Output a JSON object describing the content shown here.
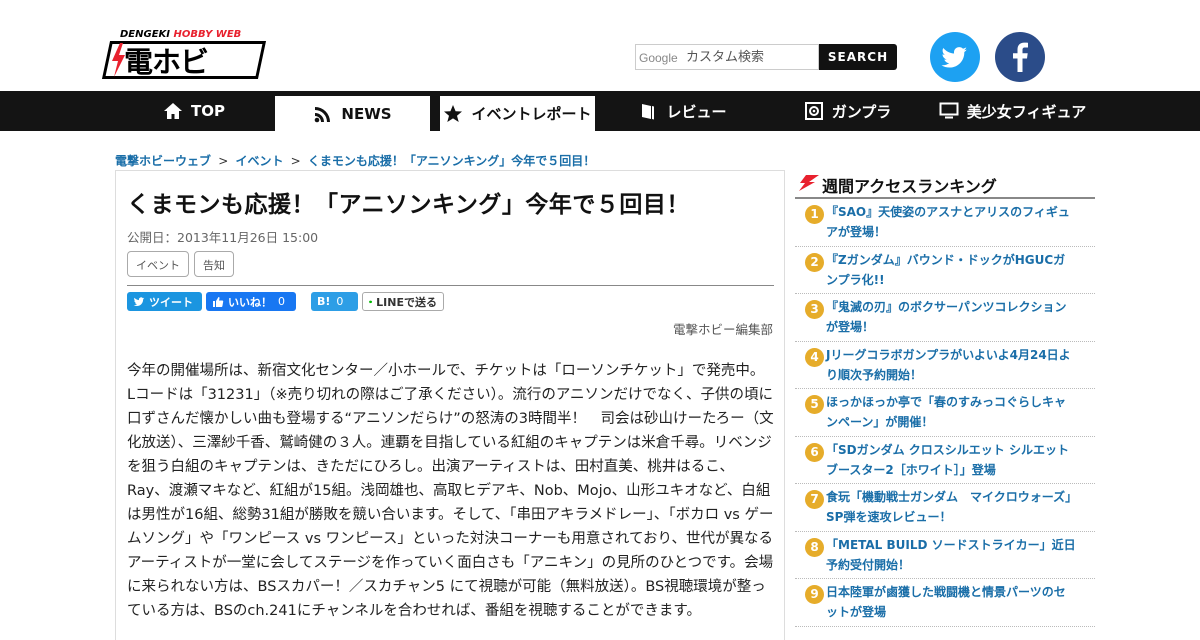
{
  "header": {
    "logo_top_a": "DENGEKI ",
    "logo_top_b": "HOBBY WEB",
    "logo_main": "電ホビ",
    "search_brand": "Google",
    "search_placeholder": "カスタム検索",
    "search_button": "SEARCH"
  },
  "nav": {
    "items": [
      {
        "label": "TOP",
        "icon": "home-icon"
      },
      {
        "label": "NEWS",
        "icon": "rss-icon"
      },
      {
        "label": "イベントレポート",
        "icon": "star-icon"
      },
      {
        "label": "レビュー",
        "icon": "book-icon"
      },
      {
        "label": "ガンプラ",
        "icon": "gear-icon"
      },
      {
        "label": "美少女フィギュア",
        "icon": "monitor-icon"
      }
    ]
  },
  "breadcrumb": {
    "items": [
      "電撃ホビーウェブ",
      "イベント",
      "くまモンも応援！「アニソンキング」今年で５回目！"
    ],
    "sep": ">"
  },
  "article": {
    "title": "くまモンも応援！「アニソンキング」今年で５回目！",
    "published": "公開日：2013年11月26日 15:00",
    "tags": [
      "イベント",
      "告知"
    ],
    "share": {
      "tweet": "ツイート",
      "like": "いいね！",
      "like_count": "0",
      "hatena": "B!",
      "hatena_count": "0",
      "line": "LINEで送る"
    },
    "author": "電撃ホビー編集部",
    "body": "今年の開催場所は、新宿文化センター／小ホールで、チケットは「ローソンチケット」で発売中。　Lコードは「31231」（※売り切れの際はご了承ください）。流行のアニソンだけでなく、子供の頃に口ずさんだ懐かしい曲も登場する“アニソンだらけ”の怒涛の3時間半！　司会は砂山けーたろー（文化放送）、三澤紗千香、鷲崎健の３人。連覇を目指している紅組のキャプテンは米倉千尋。リベンジを狙う白組のキャプテンは、きただにひろし。出演アーティストは、田村直美、桃井はるこ、Ray、渡瀬マキなど、紅組が15組。浅岡雄也、高取ヒデアキ、Nob、Mojo、山形ユキオなど、白組は男性が16組、総勢31組が勝敗を競い合います。そして、「串田アキラメドレー」、「ボカロ vs ゲームソング」や「ワンピース vs ワンピース」といった対決コーナーも用意されており、世代が異なるアーティストが一堂に会してステージを作っていく面白さも「アニキン」の見所のひとつです。会場に来られない方は、BSスカパー！／スカチャン5 にて視聴が可能（無料放送）。BS視聴環境が整っている方は、BSのch.241にチャンネルを合わせれば、番組を視聴することができます。"
  },
  "ranking": {
    "title": "週間アクセスランキング",
    "items": [
      {
        "rank": "1",
        "text": "『SAO』天使姿のアスナとアリスのフィギュアが登場！"
      },
      {
        "rank": "2",
        "text": "『Zガンダム』バウンド・ドックがHGUCガンプラ化!!"
      },
      {
        "rank": "3",
        "text": "『鬼滅の刃』のボクサーパンツコレクションが登場！"
      },
      {
        "rank": "4",
        "text": "Jリーグコラボガンプラがいよいよ4月24日より順次予約開始！"
      },
      {
        "rank": "5",
        "text": "ほっかほっか亭で「春のすみっコぐらしキャンペーン」が開催！"
      },
      {
        "rank": "6",
        "text": "「SDガンダム クロスシルエット シルエットブースター2［ホワイト］」登場"
      },
      {
        "rank": "7",
        "text": "食玩「機動戦士ガンダム　マイクロウォーズ」SP弾を速攻レビュー！"
      },
      {
        "rank": "8",
        "text": "「METAL BUILD ソードストライカー」近日予約受付開始！"
      },
      {
        "rank": "9",
        "text": "日本陸軍が鹵獲した戦闘機と情景パーツのセットが登場"
      }
    ]
  },
  "colors": {
    "nav_bg": "#141414",
    "link": "#1a6ea8",
    "rank_badge": "#e6ac2a",
    "accent_red": "#e8212e",
    "twitter": "#1da1f2",
    "facebook": "#2b4c89"
  }
}
